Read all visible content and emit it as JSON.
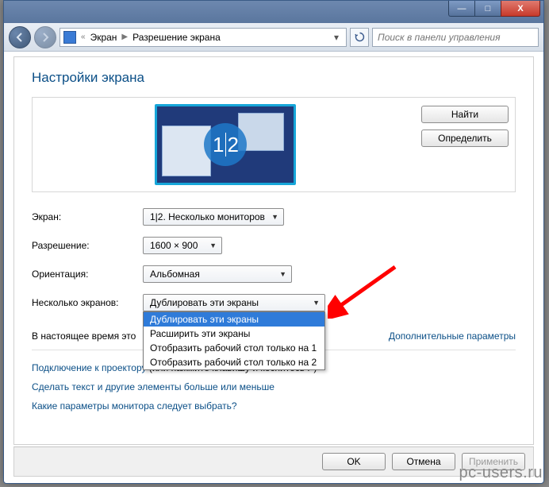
{
  "titlebar": {
    "minimize": "—",
    "maximize": "□",
    "close": "X"
  },
  "navbar": {
    "breadcrumb1": "Экран",
    "breadcrumb2": "Разрешение экрана",
    "search_placeholder": "Поиск в панели управления"
  },
  "page": {
    "title": "Настройки экрана"
  },
  "preview": {
    "badge1": "1",
    "badge2": "2"
  },
  "side_buttons": {
    "find": "Найти",
    "identify": "Определить"
  },
  "form": {
    "screen_label": "Экран:",
    "screen_value": "1|2. Несколько мониторов",
    "resolution_label": "Разрешение:",
    "resolution_value": "1600 × 900",
    "orientation_label": "Ориентация:",
    "orientation_value": "Альбомная",
    "multi_label": "Несколько экранов:",
    "multi_value": "Дублировать эти экраны",
    "multi_options": [
      "Дублировать эти экраны",
      "Расширить эти экраны",
      "Отобразить рабочий стол только на 1",
      "Отобразить рабочий стол только на 2"
    ]
  },
  "status": {
    "current_text": "В настоящее время это",
    "advanced_link": "Дополнительные параметры"
  },
  "links": {
    "projector": "Подключение к проектору",
    "projector_hint": "(или нажмите клавишу   и коснитесь P)",
    "text_size": "Сделать текст и другие элементы больше или меньше",
    "which_settings": "Какие параметры монитора следует выбрать?"
  },
  "buttons": {
    "ok": "OK",
    "cancel": "Отмена",
    "apply": "Применить"
  },
  "watermark": "pc-users.ru"
}
